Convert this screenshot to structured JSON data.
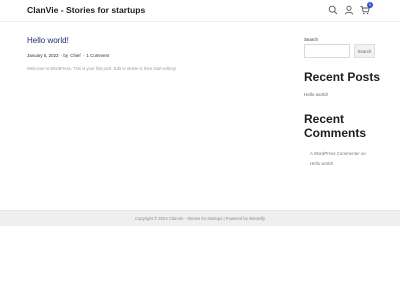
{
  "header": {
    "site_title": "ClanVie - Stories for startups",
    "icons": [
      "search-icon",
      "user-icon",
      "cart-icon"
    ],
    "cart_count": "0"
  },
  "post": {
    "title": "Hello world!",
    "date": "January 5, 2023",
    "author_prefix": "· by",
    "author": "Chief",
    "comments_prefix": "·",
    "comments": "1 Comment",
    "excerpt": "Welcome to WordPress. This is your first post. Edit or delete it, then start writing!"
  },
  "sidebar": {
    "search_label": "Search",
    "search_value": "",
    "search_placeholder": "",
    "search_button": "Search",
    "recent_posts_title": "Recent Posts",
    "recent_posts": [
      "Hello world!"
    ],
    "recent_comments_title": "Recent Comments",
    "recent_comment_author": "A WordPress Commenter on",
    "recent_comment_post": "Hello world!"
  },
  "footer": {
    "text": "Copyright © 2024 ClanVie - Stories for startups | Powered by Woostify"
  },
  "colors": {
    "accent": "#2d4fd7",
    "title": "#1b1d24",
    "footer_bg": "#efefef"
  }
}
